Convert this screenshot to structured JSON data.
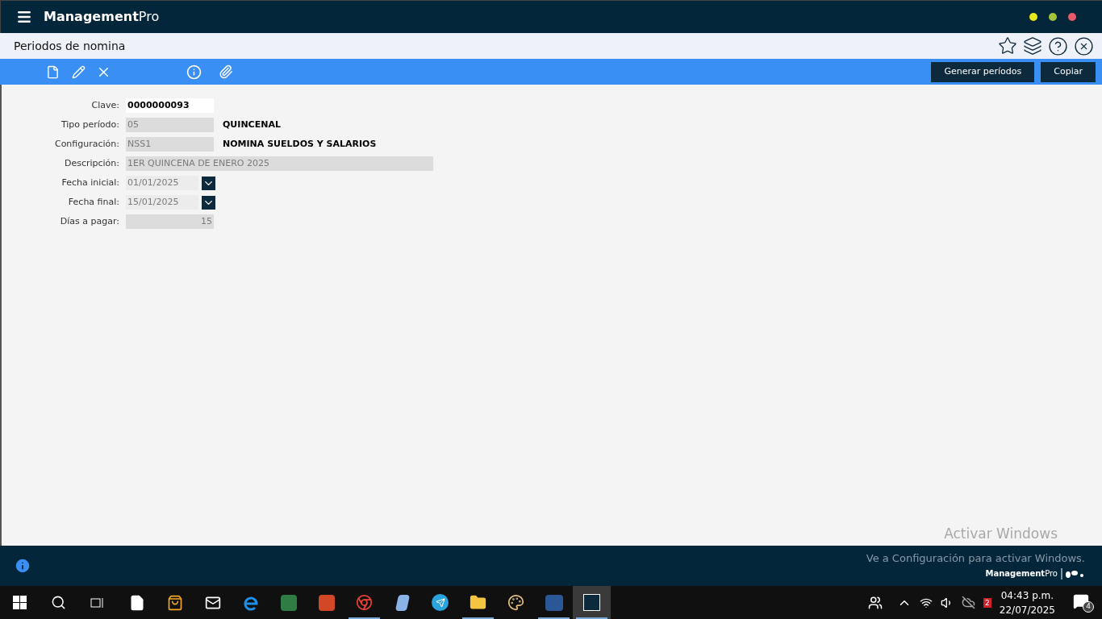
{
  "app": {
    "logo": "**Management**Pro"
  },
  "page": {
    "title": "Periodos de nomina"
  },
  "toolbar": {
    "buttons": [
      "Generar períodos",
      "Copiar"
    ]
  },
  "form": {
    "fields": [
      {
        "label": "Clave:",
        "kind": "text",
        "value": "0000000093"
      },
      {
        "label": "Tipo período:",
        "kind": "readonly",
        "value": "05",
        "detail": "QUINCENAL"
      },
      {
        "label": "Configuración:",
        "kind": "readonly",
        "value": "NSS1",
        "detail": "NOMINA SUELDOS Y SALARIOS"
      },
      {
        "label": "Descripción:",
        "kind": "wide",
        "value": "1ER QUINCENA DE ENERO 2025"
      },
      {
        "label": "Fecha inicial:",
        "kind": "date",
        "value": "01/01/2025"
      },
      {
        "label": "Fecha final:",
        "kind": "date",
        "value": "15/01/2025"
      },
      {
        "label": "Días a pagar:",
        "kind": "number",
        "value": "15"
      }
    ]
  },
  "activation": {
    "title": "Activar Windows",
    "message": "Ve a Configuración para activar Windows."
  },
  "footer": {
    "logo": "**Management**Pro"
  },
  "taskbar": {
    "apps": [
      {
        "kind": "doc",
        "active": false
      },
      {
        "kind": "store",
        "active": false
      },
      {
        "kind": "mail",
        "active": false
      },
      {
        "kind": "browser",
        "active": false
      },
      {
        "kind": "project",
        "active": false
      },
      {
        "kind": "slides",
        "active": false
      },
      {
        "kind": "chrome",
        "active": true
      },
      {
        "kind": "scan",
        "active": false
      },
      {
        "kind": "send",
        "active": false
      },
      {
        "kind": "folder",
        "active": true
      },
      {
        "kind": "paint",
        "active": false
      },
      {
        "kind": "word",
        "active": true
      },
      {
        "kind": "mp",
        "active": true,
        "selected": true
      }
    ],
    "tray_badge": "2",
    "time": "04:43 p.m.",
    "date": "22/07/2025",
    "notifications": "4"
  }
}
